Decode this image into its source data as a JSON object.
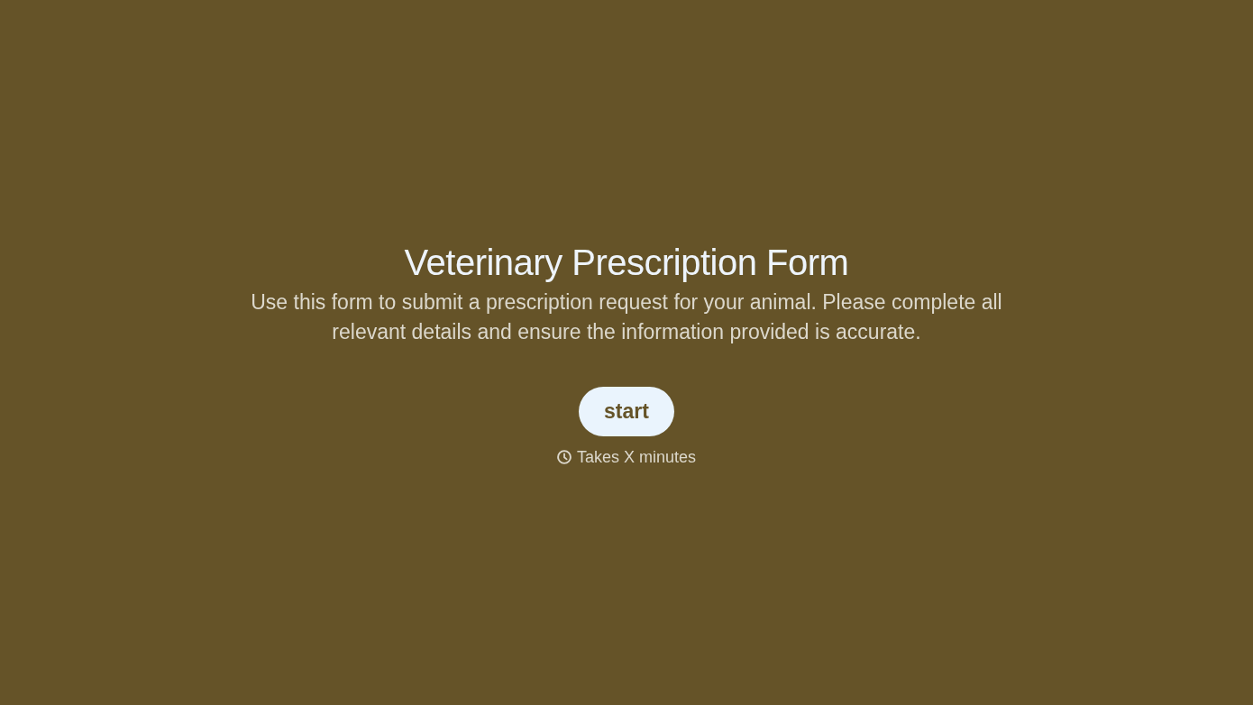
{
  "title": "Veterinary Prescription Form",
  "description": "Use this form to submit a prescription request for your animal. Please complete all relevant details and ensure the information provided is accurate.",
  "start_button": {
    "label": "start"
  },
  "duration": {
    "text": "Takes X minutes"
  }
}
